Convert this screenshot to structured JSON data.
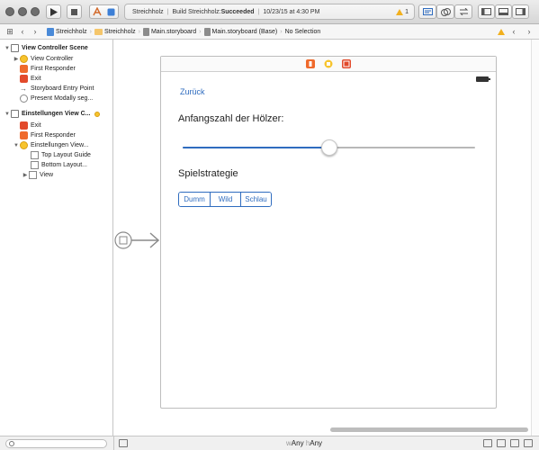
{
  "toolbar": {
    "activity": {
      "scheme": "Streichholz",
      "build_prefix": "Build Streichholz: ",
      "build_status": "Succeeded",
      "timestamp": "10/23/15 at 4:30 PM",
      "warning_count": "1"
    }
  },
  "jumpbar": {
    "crumbs": [
      "Streichholz",
      "Streichholz",
      "Main.storyboard",
      "Main.storyboard (Base)",
      "No Selection"
    ]
  },
  "outline": {
    "scene1": {
      "title": "View Controller Scene",
      "items": [
        "View Controller",
        "First Responder",
        "Exit",
        "Storyboard Entry Point",
        "Present Modally seg..."
      ]
    },
    "scene2": {
      "title": "Einstellungen View C...",
      "items": [
        "Exit",
        "First Responder",
        "Einstellungen View...",
        "Top Layout Guide",
        "Bottom Layout...",
        "View"
      ]
    }
  },
  "scene": {
    "back_label": "Zurück",
    "count_label": "Anfangszahl der Hölzer:",
    "slider_value": 0.5,
    "strategy_label": "Spielstrategie",
    "segments": [
      "Dumm",
      "Wild",
      "Schlau"
    ]
  },
  "bottom": {
    "size_w_prefix": "w",
    "size_w": "Any",
    "size_h_prefix": "h",
    "size_h": "Any"
  },
  "colors": {
    "accent": "#2f6cbf",
    "warning": "#f2b01e",
    "vc_icon": "#f7c42d",
    "exit_icon": "#e24a2b"
  }
}
